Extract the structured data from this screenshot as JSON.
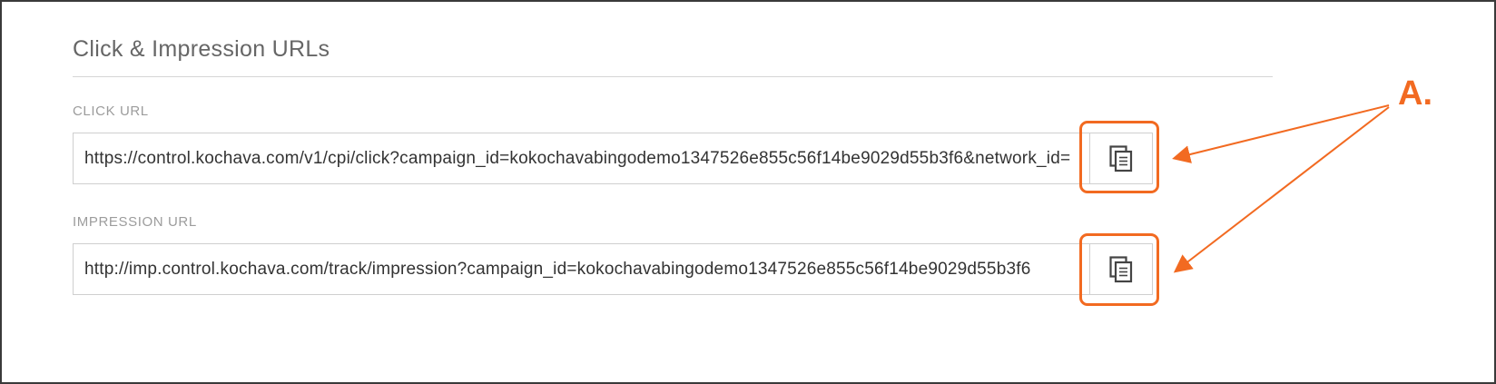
{
  "section": {
    "title": "Click & Impression URLs"
  },
  "click_url": {
    "label": "CLICK URL",
    "value": "https://control.kochava.com/v1/cpi/click?campaign_id=kokochavabingodemo1347526e855c56f14be9029d55b3f6&network_id=",
    "copy_icon": "copy-icon"
  },
  "impression_url": {
    "label": "IMPRESSION URL",
    "value": "http://imp.control.kochava.com/track/impression?campaign_id=kokochavabingodemo1347526e855c56f14be9029d55b3f6",
    "copy_icon": "copy-icon"
  },
  "annotation": {
    "callout": "A.",
    "accent_color": "#f26a21"
  }
}
